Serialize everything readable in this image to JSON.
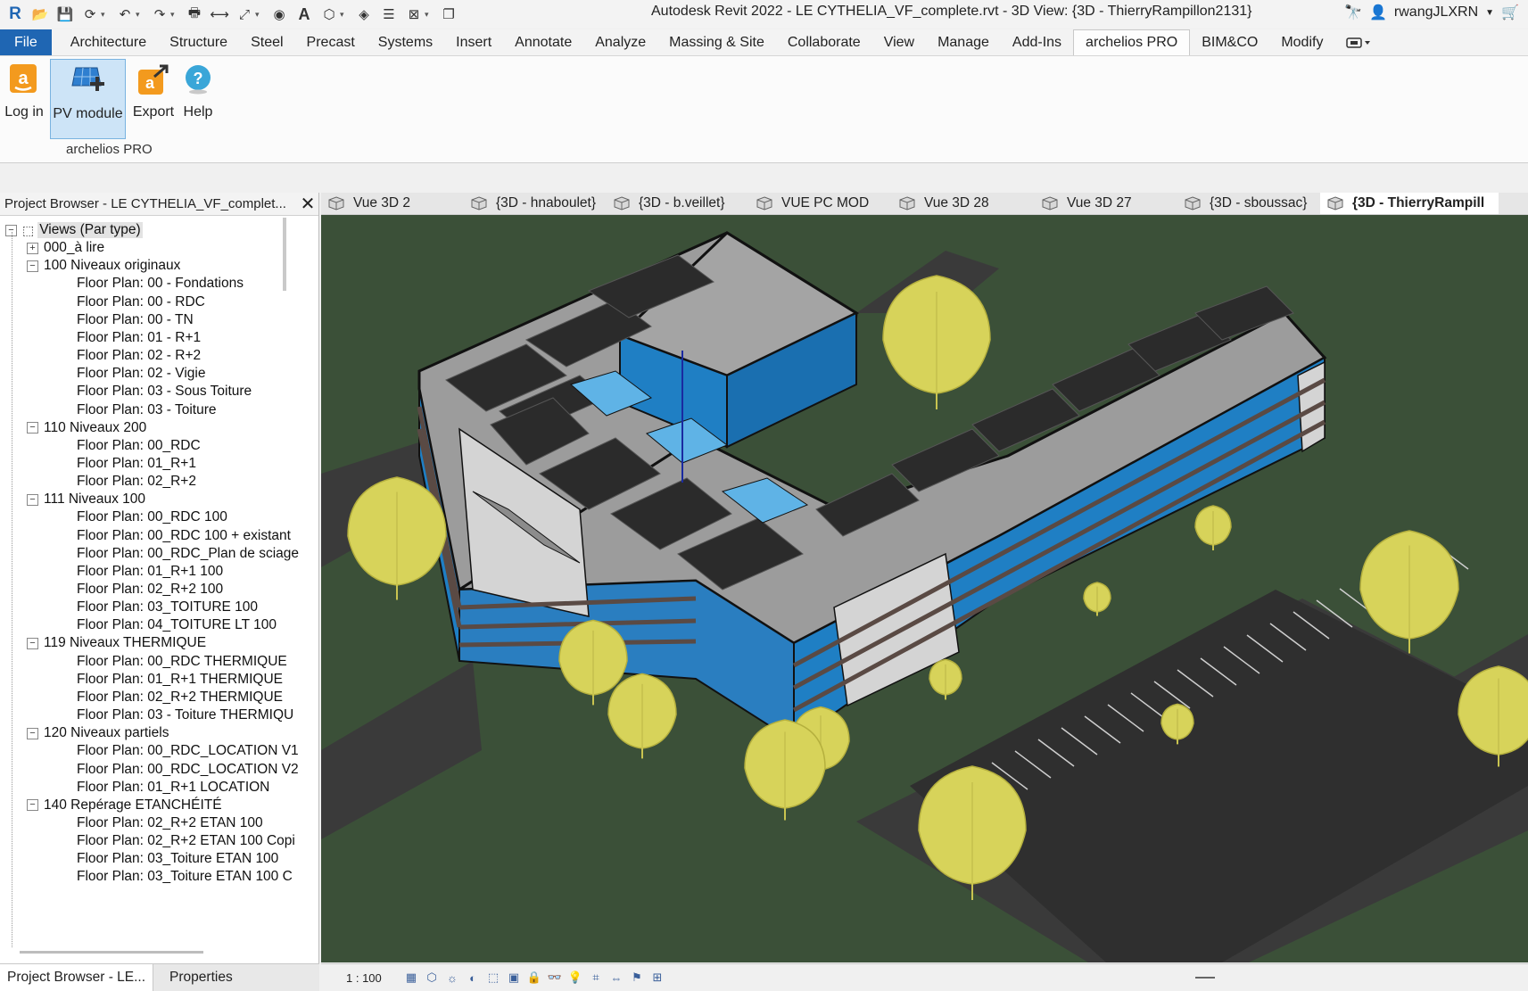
{
  "window": {
    "title": "Autodesk Revit 2022 - LE CYTHELIA_VF_complete.rvt - 3D View: {3D - ThierryRampillon2131}",
    "user": "rwangJLXRN"
  },
  "quick_access_icons": [
    "revit-logo-icon",
    "open-icon",
    "save-icon",
    "sync-icon",
    "undo-icon",
    "redo-icon",
    "print-icon",
    "measure-icon",
    "dimension-icon",
    "tag-icon",
    "text-icon",
    "3d-view-icon",
    "section-icon",
    "thin-lines-icon",
    "close-hidden-icon",
    "switch-windows-icon"
  ],
  "ribbon_tabs": [
    {
      "label": "File",
      "kind": "file"
    },
    {
      "label": "Architecture"
    },
    {
      "label": "Structure"
    },
    {
      "label": "Steel"
    },
    {
      "label": "Precast"
    },
    {
      "label": "Systems"
    },
    {
      "label": "Insert"
    },
    {
      "label": "Annotate"
    },
    {
      "label": "Analyze"
    },
    {
      "label": "Massing & Site"
    },
    {
      "label": "Collaborate"
    },
    {
      "label": "View"
    },
    {
      "label": "Manage"
    },
    {
      "label": "Add-Ins"
    },
    {
      "label": "archelios PRO",
      "active": true
    },
    {
      "label": "BIM&CO"
    },
    {
      "label": "Modify"
    }
  ],
  "ribbon_panel": {
    "buttons": [
      {
        "label": "Log in",
        "icon": "login-icon"
      },
      {
        "label": "PV module",
        "icon": "pv-module-icon",
        "selected": true
      },
      {
        "label": "Export",
        "icon": "export-icon"
      },
      {
        "label": "Help",
        "icon": "help-icon"
      }
    ],
    "panel_label": "archelios PRO"
  },
  "project_browser": {
    "title": "Project Browser - LE CYTHELIA_VF_complet...",
    "tree": [
      {
        "label": "Views (Par type)",
        "level": 0,
        "toggle": "minus",
        "root": true
      },
      {
        "label": "000_à lire",
        "level": 1,
        "toggle": "plus"
      },
      {
        "label": "100 Niveaux originaux",
        "level": 1,
        "toggle": "minus"
      },
      {
        "label": "Floor Plan: 00 - Fondations",
        "level": 2
      },
      {
        "label": "Floor Plan: 00 - RDC",
        "level": 2
      },
      {
        "label": "Floor Plan: 00 - TN",
        "level": 2
      },
      {
        "label": "Floor Plan: 01 - R+1",
        "level": 2
      },
      {
        "label": "Floor Plan: 02 - R+2",
        "level": 2
      },
      {
        "label": "Floor Plan: 02 - Vigie",
        "level": 2
      },
      {
        "label": "Floor Plan: 03 - Sous Toiture",
        "level": 2
      },
      {
        "label": "Floor Plan: 03 - Toiture",
        "level": 2
      },
      {
        "label": "110 Niveaux 200",
        "level": 1,
        "toggle": "minus"
      },
      {
        "label": "Floor Plan: 00_RDC",
        "level": 2
      },
      {
        "label": "Floor Plan: 01_R+1",
        "level": 2
      },
      {
        "label": "Floor Plan: 02_R+2",
        "level": 2
      },
      {
        "label": "111 Niveaux 100",
        "level": 1,
        "toggle": "minus"
      },
      {
        "label": "Floor Plan: 00_RDC 100",
        "level": 2
      },
      {
        "label": "Floor Plan: 00_RDC 100 + existant",
        "level": 2
      },
      {
        "label": "Floor Plan: 00_RDC_Plan de sciage",
        "level": 2
      },
      {
        "label": "Floor Plan: 01_R+1 100",
        "level": 2
      },
      {
        "label": "Floor Plan: 02_R+2 100",
        "level": 2
      },
      {
        "label": "Floor Plan: 03_TOITURE 100",
        "level": 2
      },
      {
        "label": "Floor Plan: 04_TOITURE LT 100",
        "level": 2
      },
      {
        "label": "119 Niveaux THERMIQUE",
        "level": 1,
        "toggle": "minus"
      },
      {
        "label": "Floor Plan: 00_RDC THERMIQUE",
        "level": 2
      },
      {
        "label": "Floor Plan: 01_R+1 THERMIQUE",
        "level": 2
      },
      {
        "label": "Floor Plan: 02_R+2 THERMIQUE",
        "level": 2
      },
      {
        "label": "Floor Plan: 03 - Toiture THERMIQU",
        "level": 2
      },
      {
        "label": "120 Niveaux partiels",
        "level": 1,
        "toggle": "minus"
      },
      {
        "label": "Floor Plan: 00_RDC_LOCATION V1",
        "level": 2
      },
      {
        "label": "Floor Plan: 00_RDC_LOCATION V2",
        "level": 2
      },
      {
        "label": "Floor Plan: 01_R+1 LOCATION",
        "level": 2
      },
      {
        "label": "140 Repérage ETANCHÉITÉ",
        "level": 1,
        "toggle": "minus"
      },
      {
        "label": "Floor Plan: 02_R+2 ETAN 100",
        "level": 2
      },
      {
        "label": "Floor Plan: 02_R+2 ETAN 100 Copi",
        "level": 2
      },
      {
        "label": "Floor Plan: 03_Toiture ETAN 100",
        "level": 2
      },
      {
        "label": "Floor Plan: 03_Toiture ETAN 100 C",
        "level": 2
      }
    ]
  },
  "bottom_tabs": [
    {
      "label": "Project Browser - LE...",
      "active": true
    },
    {
      "label": "Properties"
    }
  ],
  "view_tabs": [
    {
      "label": "Vue 3D 2"
    },
    {
      "label": "{3D - hnaboulet}"
    },
    {
      "label": "{3D - b.veillet}"
    },
    {
      "label": "VUE PC MOD"
    },
    {
      "label": "Vue 3D 28"
    },
    {
      "label": "Vue 3D 27"
    },
    {
      "label": "{3D - sboussac}"
    },
    {
      "label": "{3D - ThierryRampill",
      "active": true
    }
  ],
  "view_controls": {
    "scale": "1 : 100",
    "icons": [
      "detail-level-icon",
      "visual-style-icon",
      "sun-path-icon",
      "shadows-icon",
      "crop-view-icon",
      "show-crop-icon",
      "lock-3d-icon",
      "temporary-hide-icon",
      "reveal-hidden-icon",
      "analytical-model-icon",
      "highlight-displacement-icon",
      "worksharing-icon",
      "constraints-icon"
    ]
  },
  "colors": {
    "file_tab": "#1f66b3",
    "grass": "#3b5038",
    "road": "#3a3a3a",
    "roof": "#9c9c9c",
    "pv_panel": "#2b2b2b",
    "glazing": "#1f7fc4",
    "wall": "#d4d4d4",
    "tree": "#d7d35a"
  }
}
